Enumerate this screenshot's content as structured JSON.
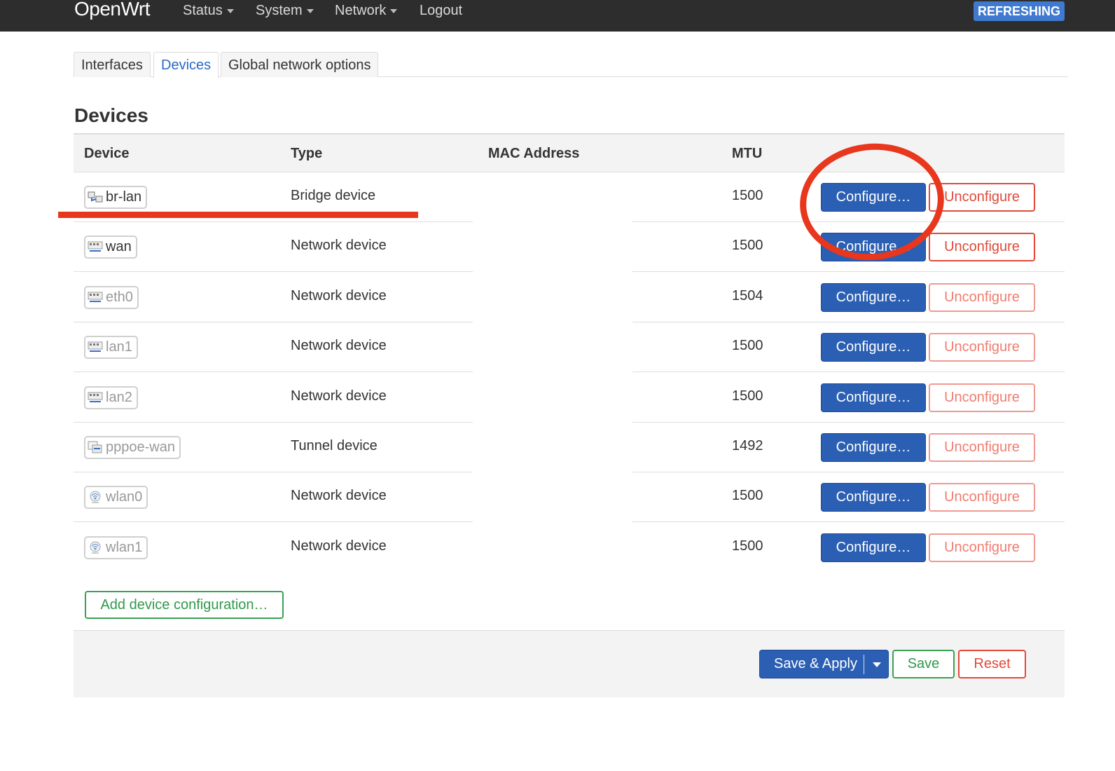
{
  "nav": {
    "brand": "OpenWrt",
    "menu": [
      "Status",
      "System",
      "Network",
      "Logout"
    ],
    "status_badge": "REFRESHING"
  },
  "tabs": [
    {
      "label": "Interfaces"
    },
    {
      "label": "Devices",
      "active": true
    },
    {
      "label": "Global network options"
    }
  ],
  "heading": "Devices",
  "table": {
    "headers": [
      "Device",
      "Type",
      "MAC Address",
      "MTU"
    ],
    "rows": [
      {
        "device": "br-lan",
        "type": "Bridge device",
        "mac": "",
        "mtu": "1500",
        "icon": "bridge-icon"
      },
      {
        "device": "wan",
        "type": "Network device",
        "mac": "",
        "mtu": "1500",
        "icon": "ethernet-port-icon"
      },
      {
        "device": "eth0",
        "type": "Network device",
        "mac": "",
        "mtu": "1504",
        "icon": "ethernet-port-icon"
      },
      {
        "device": "lan1",
        "type": "Network device",
        "mac": "",
        "mtu": "1500",
        "icon": "ethernet-port-icon"
      },
      {
        "device": "lan2",
        "type": "Network device",
        "mac": "",
        "mtu": "1500",
        "icon": "ethernet-port-icon"
      },
      {
        "device": "pppoe-wan",
        "type": "Tunnel device",
        "mac": "",
        "mtu": "1492",
        "icon": "tunnel-icon"
      },
      {
        "device": "wlan0",
        "type": "Network device",
        "mac": "",
        "mtu": "1500",
        "icon": "wireless-icon"
      },
      {
        "device": "wlan1",
        "type": "Network device",
        "mac": "",
        "mtu": "1500",
        "icon": "wireless-icon"
      }
    ],
    "configure_label": "Configure…",
    "unconfigure_label": "Unconfigure"
  },
  "add_button": "Add device configuration…",
  "footer": {
    "save_apply": "Save & Apply",
    "save": "Save",
    "reset": "Reset"
  },
  "colors": {
    "primary": "#2b5fb3",
    "danger": "#e04a3a",
    "positive": "#3aa155",
    "annotation": "#e8371c"
  }
}
